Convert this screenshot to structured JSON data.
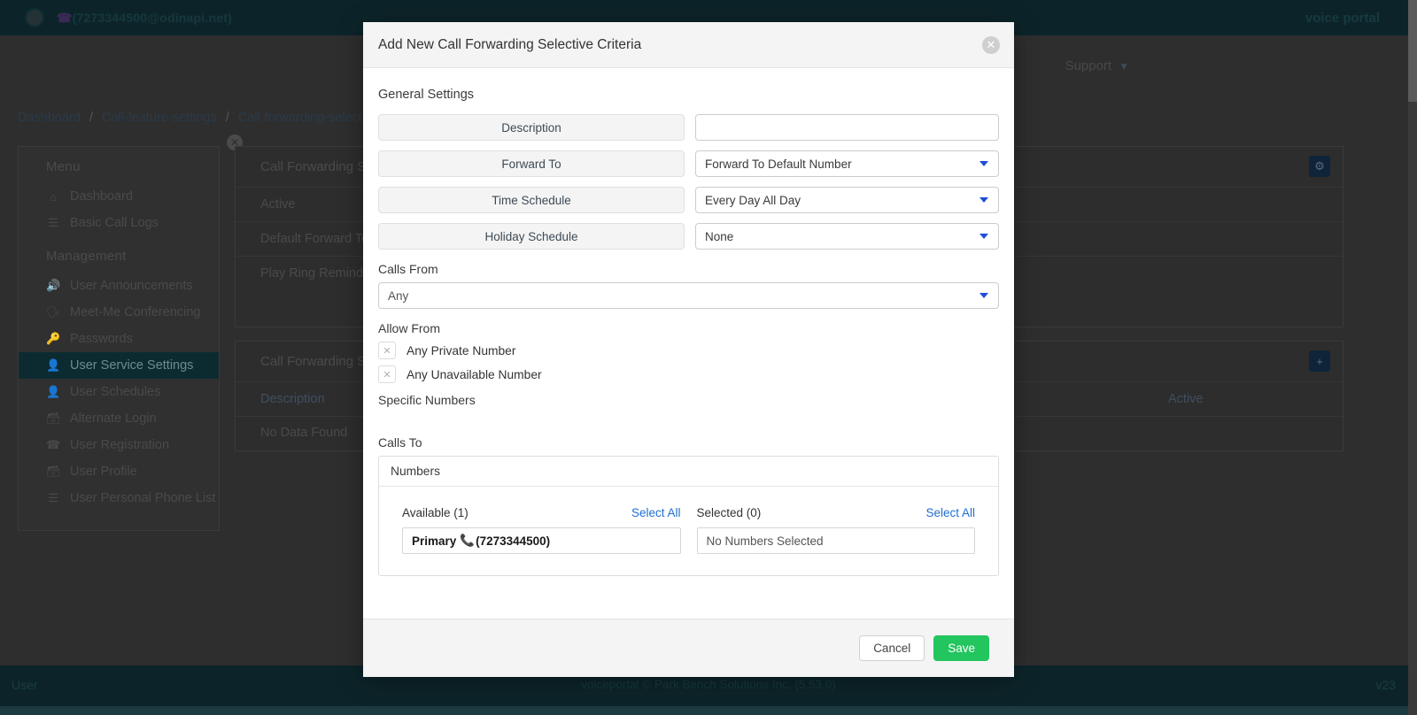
{
  "app": {
    "brand_user": "(7273344500@odinapi.net)",
    "brand_right": "voice portal",
    "nav_support": "Support",
    "breadcrumb": [
      "Dashboard",
      "Call-feature-settings",
      "Call-forwarding-selective"
    ],
    "breadcrumb_sep": "/"
  },
  "sidebar": {
    "heading_menu": "Menu",
    "heading_management": "Management",
    "menu_items": [
      {
        "label": "Dashboard",
        "icon": "home-icon",
        "glyph": "⌂"
      },
      {
        "label": "Basic Call Logs",
        "icon": "list-icon",
        "glyph": "☰"
      }
    ],
    "management_items": [
      {
        "label": "User Announcements",
        "icon": "megaphone-icon",
        "glyph": "🔊",
        "active": false
      },
      {
        "label": "Meet-Me Conferencing",
        "icon": "conference-icon",
        "glyph": "🗣",
        "active": false
      },
      {
        "label": "Passwords",
        "icon": "key-icon",
        "glyph": "🔑",
        "active": false
      },
      {
        "label": "User Service Settings",
        "icon": "user-gear-icon",
        "glyph": "👤",
        "active": true
      },
      {
        "label": "User Schedules",
        "icon": "user-clock-icon",
        "glyph": "👤",
        "active": false
      },
      {
        "label": "Alternate Login",
        "icon": "id-card-icon",
        "glyph": "📇",
        "active": false
      },
      {
        "label": "User Registration",
        "icon": "phone-icon",
        "glyph": "☎",
        "active": false
      },
      {
        "label": "User Profile",
        "icon": "profile-card-icon",
        "glyph": "📇",
        "active": false
      },
      {
        "label": "User Personal Phone List",
        "icon": "list-icon",
        "glyph": "☰",
        "active": false
      }
    ]
  },
  "background": {
    "panel_a_title": "Call Forwarding Selective",
    "panel_a_rows": [
      "Active",
      "Default Forward To Phone Number",
      "Play Ring Reminder When A Call Is Forwarded"
    ],
    "panel_a_icon": "gear-icon",
    "panel_b_title": "Call Forwarding Selective Criteria",
    "panel_b_icon": "plus-icon",
    "table_headers": [
      "Description",
      "Active"
    ],
    "table_rows": [
      [
        "No Data Found",
        ""
      ]
    ],
    "close_badge": "close-icon"
  },
  "footer": {
    "left": "User",
    "center": "voiceportal © Park Bench Solutions Inc. (5.53.0)",
    "right": "v23"
  },
  "modal": {
    "title": "Add New Call Forwarding Selective Criteria",
    "close_icon": "close-icon",
    "general_settings_label": "General Settings",
    "fields": [
      {
        "label": "Description",
        "value": "",
        "type": "text",
        "placeholder": ""
      },
      {
        "label": "Forward To",
        "value": "Forward To Default Number",
        "type": "select",
        "placeholder": ""
      },
      {
        "label": "Time Schedule",
        "value": "Every Day All Day",
        "type": "select",
        "placeholder": ""
      },
      {
        "label": "Holiday Schedule",
        "value": "None",
        "type": "select",
        "placeholder": ""
      }
    ],
    "calls_from_label": "Calls From",
    "calls_from_value": "Any",
    "allow_from_label": "Allow From",
    "allow_from_items": [
      "Any Private Number",
      "Any Unavailable Number"
    ],
    "specific_numbers_label": "Specific Numbers",
    "calls_to_label": "Calls To",
    "numbers": {
      "box_title": "Numbers",
      "available_title": "Available (1)",
      "available_select_all": "Select All",
      "available_item": "Primary 📞(7273344500)",
      "available_item_name": "Primary",
      "available_item_number": "(7273344500)",
      "selected_title": "Selected (0)",
      "selected_select_all": "Select All",
      "selected_empty": "No Numbers Selected"
    },
    "cancel_label": "Cancel",
    "save_label": "Save"
  },
  "colors": {
    "brand_dark": "#0c2429",
    "accent_blue": "#1f6fd0",
    "save_green": "#22c55e"
  }
}
